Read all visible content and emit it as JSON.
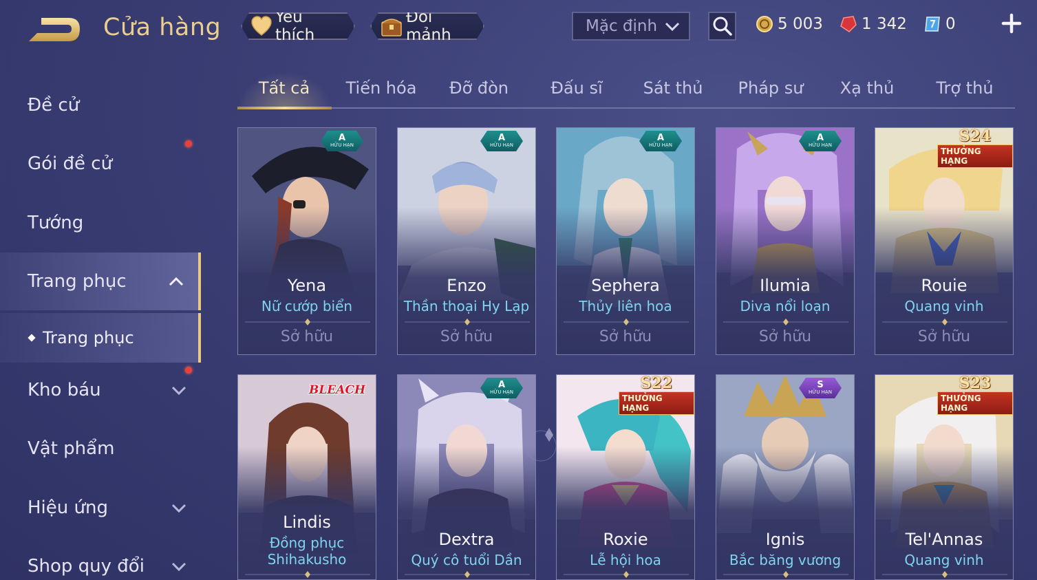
{
  "header": {
    "title": "Cửa hàng",
    "favorite_label": "Yêu thích",
    "shard_label": "Đổi mảnh",
    "sort_value": "Mặc định",
    "currencies": [
      {
        "name": "gold-coin",
        "value": "5 003"
      },
      {
        "name": "ruby",
        "value": "1 342"
      },
      {
        "name": "voucher",
        "value": "0"
      }
    ]
  },
  "sidebar": {
    "items": [
      {
        "label": "Đề cử"
      },
      {
        "label": "Gói đề cử"
      },
      {
        "label": "Tướng"
      },
      {
        "label": "Trang phục"
      },
      {
        "label": "Trang phục"
      },
      {
        "label": "Kho báu"
      },
      {
        "label": "Vật phẩm"
      },
      {
        "label": "Hiệu ứng"
      },
      {
        "label": "Shop quy đổi"
      }
    ]
  },
  "tabs": [
    "Tất cả",
    "Tiến hóa",
    "Đỡ đòn",
    "Đấu sĩ",
    "Sát thủ",
    "Pháp sư",
    "Xạ thủ",
    "Trợ thủ"
  ],
  "cards_row1": [
    {
      "hero": "Yena",
      "skin": "Nữ cướp biển",
      "status": "Sở hữu",
      "badge": "A",
      "badge_sub": "HỮU HẠN"
    },
    {
      "hero": "Enzo",
      "skin": "Thần thoại Hy Lạp",
      "status": "Sở hữu",
      "badge": "A",
      "badge_sub": "HỮU HẠN"
    },
    {
      "hero": "Sephera",
      "skin": "Thủy liên hoa",
      "status": "Sở hữu",
      "badge": "A",
      "badge_sub": "HỮU HẠN"
    },
    {
      "hero": "Ilumia",
      "skin": "Diva nổi loạn",
      "status": "Sở hữu",
      "badge": "A",
      "badge_sub": "HỮU HẠN"
    },
    {
      "hero": "Rouie",
      "skin": "Quang vinh",
      "status": "Sở hữu",
      "season": "S24",
      "season_sub": "THƯỞNG HẠNG"
    }
  ],
  "cards_row2": [
    {
      "hero": "Lindis",
      "skin_line1": "Đồng phục",
      "skin_line2": "Shihakusho",
      "collab": "BLEACH"
    },
    {
      "hero": "Dextra",
      "skin": "Quý cô tuổi Dần",
      "badge": "A",
      "badge_sub": "HỮU HẠN"
    },
    {
      "hero": "Roxie",
      "skin": "Lễ hội hoa",
      "season": "S22",
      "season_sub": "THƯỞNG HẠNG"
    },
    {
      "hero": "Ignis",
      "skin": "Bắc băng vương",
      "badge": "S",
      "badge_sub": "HỮU HẠN"
    },
    {
      "hero": "Tel'Annas",
      "skin": "Quang vinh",
      "season": "S23",
      "season_sub": "THƯỞNG HẠNG"
    }
  ],
  "colors": {
    "background": "#3a3e74",
    "gold_accent": "#e8c985",
    "skin_name": "#7fd4ef",
    "notification": "#e8413a"
  }
}
